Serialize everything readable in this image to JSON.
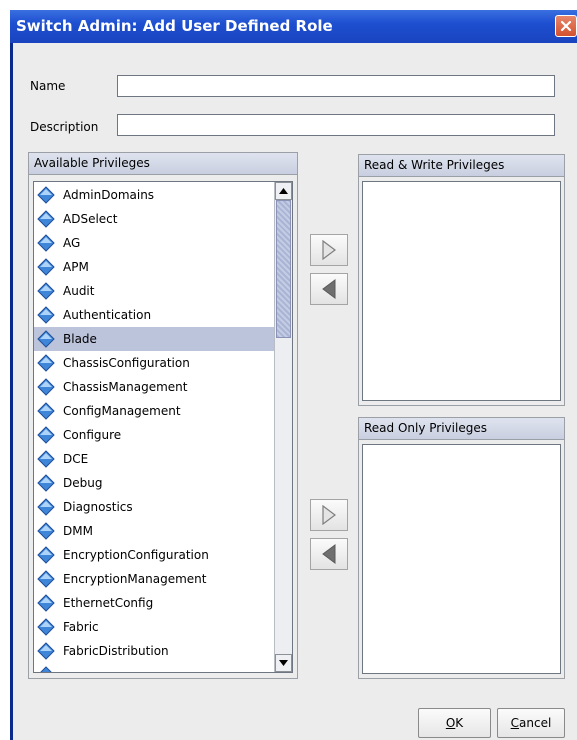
{
  "window": {
    "title": "Switch Admin: Add User Defined Role"
  },
  "form": {
    "name_label": "Name",
    "name_value": "",
    "description_label": "Description",
    "description_value": ""
  },
  "available": {
    "header": "Available Privileges",
    "items": [
      "AdminDomains",
      "ADSelect",
      "AG",
      "APM",
      "Audit",
      "Authentication",
      "Blade",
      "ChassisConfiguration",
      "ChassisManagement",
      "ConfigManagement",
      "Configure",
      "DCE",
      "Debug",
      "Diagnostics",
      "DMM",
      "EncryptionConfiguration",
      "EncryptionManagement",
      "EthernetConfig",
      "Fabric",
      "FabricDistribution"
    ],
    "selected": "Blade"
  },
  "read_write": {
    "header": "Read & Write Privileges",
    "items": []
  },
  "read_only": {
    "header": "Read Only Privileges",
    "items": []
  },
  "buttons": {
    "ok_mnemonic": "O",
    "ok_rest": "K",
    "cancel_mnemonic": "C",
    "cancel_rest": "ancel"
  },
  "icons": {
    "privilege": "privilege-diamond-icon",
    "add": "arrow-right-icon",
    "remove": "arrow-left-icon",
    "close": "close-icon"
  },
  "colors": {
    "title_bar": "#1d4fd0",
    "close_button": "#d2512f",
    "selection": "#bcc4dc",
    "diamond_icon": "#3f86d8"
  }
}
